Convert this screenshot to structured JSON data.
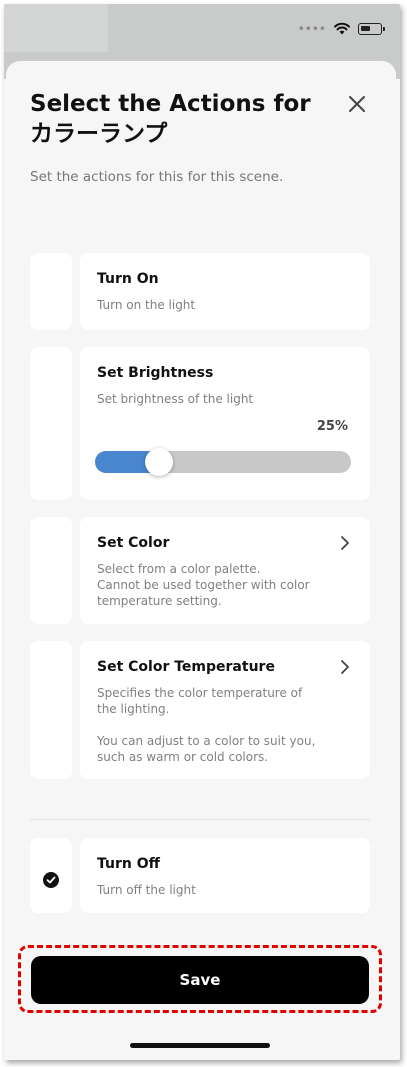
{
  "status_bar": {
    "signal_dots": "••••",
    "wifi_icon": "wifi-icon",
    "battery_icon": "battery-icon"
  },
  "sheet": {
    "title": "Select the Actions for カラーランプ",
    "subtitle": "Set the actions for this for this scene.",
    "close_icon": "close-icon"
  },
  "actions": [
    {
      "title": "Turn On",
      "description": "Turn on the light",
      "selected": false
    },
    {
      "title": "Set Brightness",
      "description": "Set brightness of the light",
      "value_label": "25%",
      "value": 0.25,
      "selected": false
    },
    {
      "title": "Set Color",
      "description": "Select from a color palette.\n Cannot be used together with color temperature setting.",
      "selected": false,
      "has_chevron": true
    },
    {
      "title": "Set Color Temperature",
      "description": "Specifies the color temperature of the lighting.\n\nYou can adjust to a color to suit you, such as warm or cold colors.",
      "selected": false,
      "has_chevron": true
    },
    {
      "title": "Turn Off",
      "description": "Turn off the light",
      "selected": true
    }
  ],
  "footer": {
    "save_label": "Save"
  },
  "colors": {
    "accent": "#4a86cf",
    "primary_button": "#000000",
    "highlight_border": "#e00000"
  }
}
